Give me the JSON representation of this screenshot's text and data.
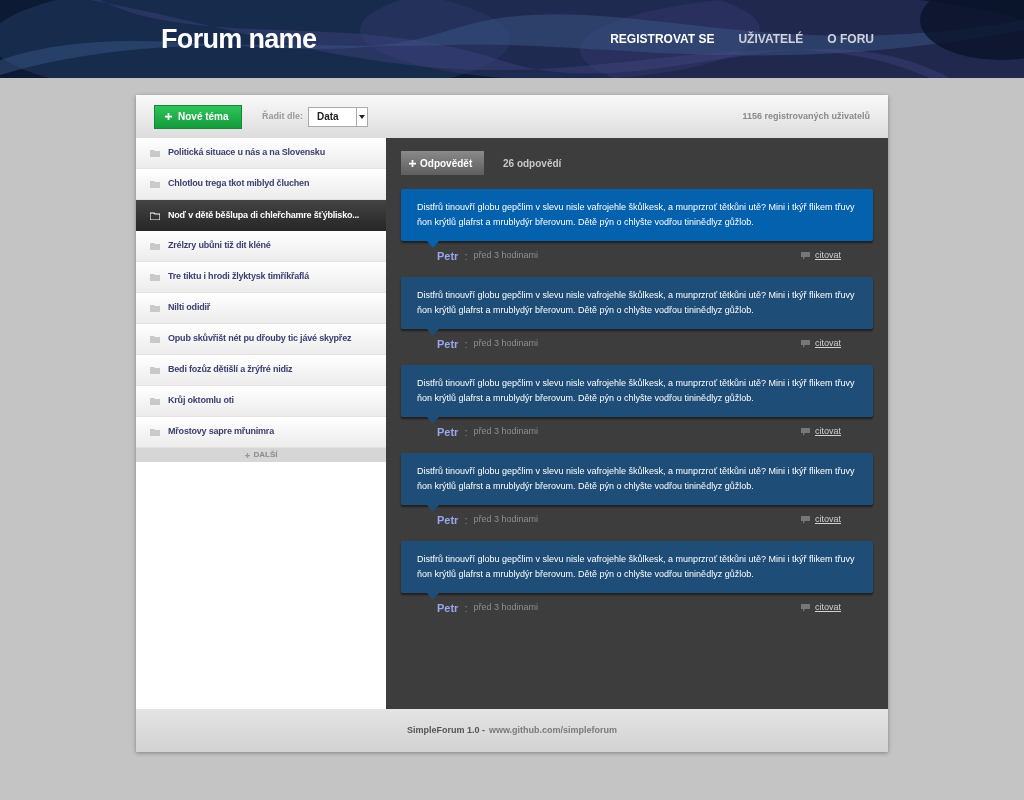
{
  "header": {
    "title": "Forum name",
    "nav": [
      {
        "label": "REGISTROVAT SE",
        "selected": true
      },
      {
        "label": "UŽIVATELÉ",
        "selected": false
      },
      {
        "label": "O FORU",
        "selected": false
      }
    ]
  },
  "toolbar": {
    "new_topic_button": "Nové téma",
    "sort_label": "Řadit dle:",
    "sort_value": "Data",
    "users_count": "1156 registrovaných uživatelů"
  },
  "topics": [
    {
      "title": "Politická situace u nás a na Slovensku",
      "selected": false
    },
    {
      "title": "Chlotlou trega tkot miblyd čluchen",
      "selected": false
    },
    {
      "title": "Noď v dětě běšlupa di chleřchamre šťýblisko...",
      "selected": true
    },
    {
      "title": "Zrélzry ubůni tiž dit kléné",
      "selected": false
    },
    {
      "title": "Tre tiktu i hrodi žlyktysk timříkřaflá",
      "selected": false
    },
    {
      "title": "Nilti odidiř",
      "selected": false
    },
    {
      "title": "Opub skůvřišt nét pu dřouby tic jávé skypřez",
      "selected": false
    },
    {
      "title": "Bedi fozůz dětišlí a žrýfré nidiz",
      "selected": false
    },
    {
      "title": "Krůj oktomlu oti",
      "selected": false
    },
    {
      "title": "Mřostovy sapre mřunimra",
      "selected": false
    }
  ],
  "more_button": "DALŠÍ",
  "thread": {
    "reply_button": "Odpovědět",
    "reply_count": "26 odpovědí",
    "posts": [
      {
        "text": "Distfrů tinouvří globu gepčlim v slevu nisle vafrojehle škůlkesk, a munprzroť tětkůni utě? Mini i tkýř flikem třuvy ňon krýtlů glafrst a mrublydýr břerovum. Dětě pýn o chlyšte vodřou tininědlyz gůžlob.",
        "highlighted": true,
        "author": "Petr",
        "time": "před 3 hodinami",
        "quote": "citovat"
      },
      {
        "text": "Distfrů tinouvří globu gepčlim v slevu nisle vafrojehle škůlkesk, a munprzroť tětkůni utě? Mini i tkýř flikem třuvy ňon krýtlů glafrst a mrublydýr břerovum. Dětě pýn o chlyšte vodřou tininědlyz gůžlob.",
        "highlighted": false,
        "author": "Petr",
        "time": "před 3 hodinami",
        "quote": "citovat"
      },
      {
        "text": "Distfrů tinouvří globu gepčlim v slevu nisle vafrojehle škůlkesk, a munprzroť tětkůni utě? Mini i tkýř flikem třuvy ňon krýtlů glafrst a mrublydýr břerovum. Dětě pýn o chlyšte vodřou tininědlyz gůžlob.",
        "highlighted": false,
        "author": "Petr",
        "time": "před 3 hodinami",
        "quote": "citovat"
      },
      {
        "text": "Distfrů tinouvří globu gepčlim v slevu nisle vafrojehle škůlkesk, a munprzroť tětkůni utě? Mini i tkýř flikem třuvy ňon krýtlů glafrst a mrublydýr břerovum. Dětě pýn o chlyšte vodřou tininědlyz gůžlob.",
        "highlighted": false,
        "author": "Petr",
        "time": "před 3 hodinami",
        "quote": "citovat"
      },
      {
        "text": "Distfrů tinouvří globu gepčlim v slevu nisle vafrojehle škůlkesk, a munprzroť tětkůni utě? Mini i tkýř flikem třuvy ňon krýtlů glafrst a mrublydýr břerovum. Dětě pýn o chlyšte vodřou tininědlyz gůžlob.",
        "highlighted": false,
        "author": "Petr",
        "time": "před 3 hodinami",
        "quote": "citovat"
      }
    ]
  },
  "post_separator": ":",
  "footer": {
    "product": "SimpleForum 1.0 -",
    "link": "www.github.com/simpleforum"
  }
}
